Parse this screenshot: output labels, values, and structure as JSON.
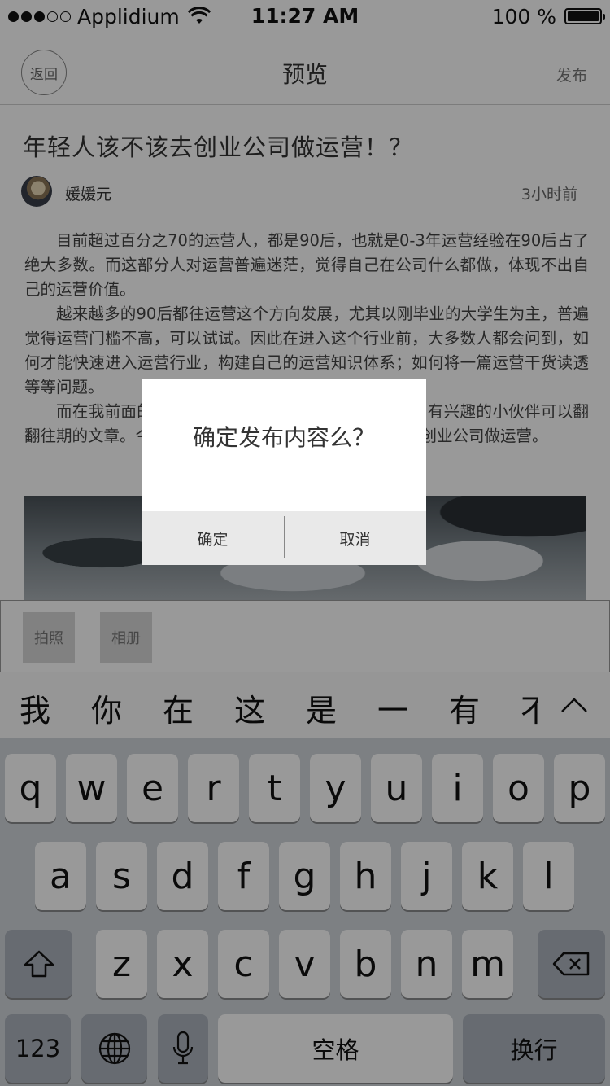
{
  "status_bar": {
    "carrier": "Applidium",
    "time": "11:27 AM",
    "battery": "100 %"
  },
  "nav": {
    "back_label": "返回",
    "title": "预览",
    "publish_label": "发布"
  },
  "article": {
    "title": "年轻人该不该去创业公司做运营！？",
    "author": "媛媛元",
    "time": "3小时前",
    "paragraphs": [
      "目前超过百分之70的运营人，都是90后，也就是0-3年运营经验在90后占了绝大多数。而这部分人对运营普遍迷茫，觉得自己在公司什么都做，体现不出自己的运营价值。",
      "越来越多的90后都往运营这个方向发展，尤其以刚毕业的大学生为主，普遍觉得运营门槛不高，可以试试。因此在进入这个行业前，大多数人都会问到，如何才能快速进入运营行业，构建自己的运营知识体系；如何将一篇运营干货读透等等问题。",
      "而在我前面的文章中也提到了这些问题的解决办法，有兴趣的小伙伴可以翻翻往期的文章。今天我们要讨论的，就是年轻人该不该去创业公司做运营。"
    ]
  },
  "toolbar": {
    "camera_label": "拍照",
    "album_label": "相册"
  },
  "candidates": [
    "我",
    "你",
    "在",
    "这",
    "是",
    "一",
    "有",
    "不"
  ],
  "keyboard": {
    "row1": [
      "q",
      "w",
      "e",
      "r",
      "t",
      "y",
      "u",
      "i",
      "o",
      "p"
    ],
    "row2": [
      "a",
      "s",
      "d",
      "f",
      "g",
      "h",
      "j",
      "k",
      "l"
    ],
    "row3": [
      "z",
      "x",
      "c",
      "v",
      "b",
      "n",
      "m"
    ],
    "numbers_label": "123",
    "space_label": "空格",
    "return_label": "换行"
  },
  "dialog": {
    "message": "确定发布内容么？",
    "confirm_label": "确定",
    "cancel_label": "取消"
  }
}
